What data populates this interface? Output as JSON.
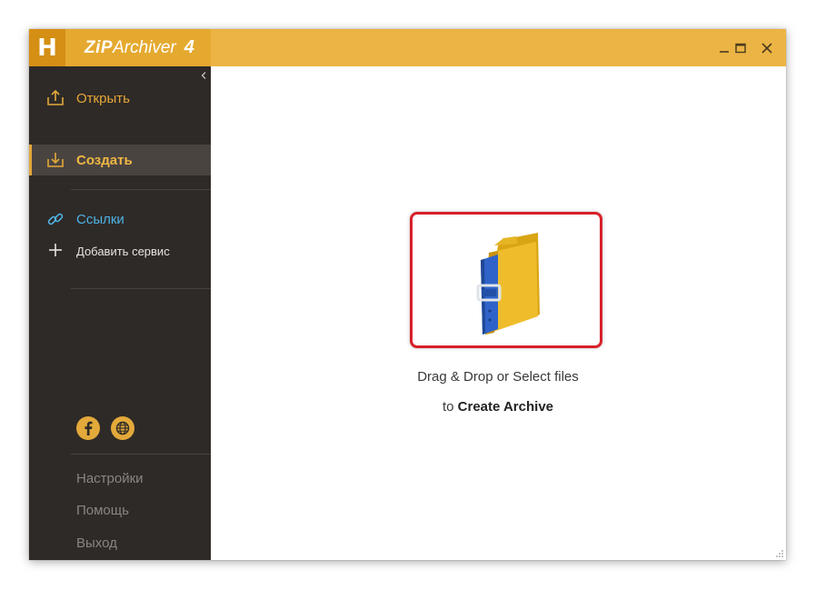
{
  "titlebar": {
    "logo_letter": "H",
    "app_name_bold": "ZiP",
    "app_name_rest": " Archiver",
    "app_version": "4",
    "icons": [
      "minimize-icon",
      "maximize-icon",
      "close-icon"
    ]
  },
  "sidebar": {
    "items": [
      {
        "label": "Открыть",
        "icon": "open-export-icon"
      },
      {
        "label": "Создать",
        "icon": "create-import-icon",
        "active": true
      },
      {
        "label": "Ссылки",
        "icon": "link-icon"
      },
      {
        "label": "Добавить сервис",
        "icon": "plus-icon"
      }
    ],
    "social_icons": [
      "facebook-icon",
      "globe-icon"
    ],
    "bottom": {
      "settings": "Настройки",
      "help": "Помощь",
      "exit": "Выход"
    }
  },
  "main": {
    "drop_line1": "Drag & Drop or Select files",
    "drop_line2_prefix": "to ",
    "drop_line2_bold": "Create Archive"
  },
  "colors": {
    "accent": "#ecb444",
    "accent_dark": "#d58f14",
    "sidebar_bg": "#2e2a27",
    "sidebar_active_bg": "#4a4440",
    "link_blue": "#4fb3e6",
    "highlight_red": "#d8202a"
  }
}
